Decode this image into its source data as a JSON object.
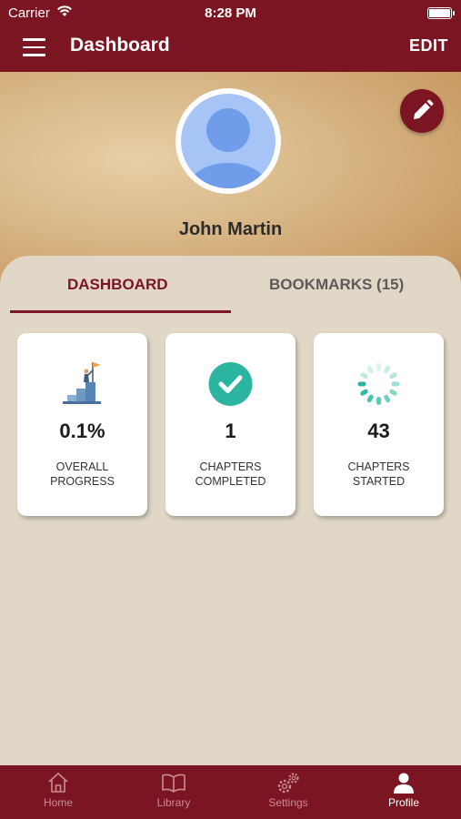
{
  "status_bar": {
    "carrier": "Carrier",
    "time": "8:28 PM"
  },
  "header": {
    "title": "Dashboard",
    "edit_label": "EDIT"
  },
  "profile": {
    "name": "John Martin"
  },
  "tabs": [
    {
      "label": "DASHBOARD",
      "active": true
    },
    {
      "label": "BOOKMARKS (15)",
      "active": false
    }
  ],
  "stats": [
    {
      "value": "0.1%",
      "label_line1": "OVERALL",
      "label_line2": "PROGRESS",
      "icon": "progress-climb-icon"
    },
    {
      "value": "1",
      "label_line1": "CHAPTERS",
      "label_line2": "COMPLETED",
      "icon": "check-circle-icon"
    },
    {
      "value": "43",
      "label_line1": "CHAPTERS",
      "label_line2": "STARTED",
      "icon": "spinner-icon"
    }
  ],
  "bottom_nav": [
    {
      "label": "Home",
      "icon": "home-icon",
      "active": false
    },
    {
      "label": "Library",
      "icon": "book-icon",
      "active": false
    },
    {
      "label": "Settings",
      "icon": "gears-icon",
      "active": false
    },
    {
      "label": "Profile",
      "icon": "person-icon",
      "active": true
    }
  ],
  "colors": {
    "primary": "#7c1522",
    "background": "#e0d7c6",
    "accent_teal": "#2bb5a0",
    "avatar_blue": "#a7c4f6"
  }
}
